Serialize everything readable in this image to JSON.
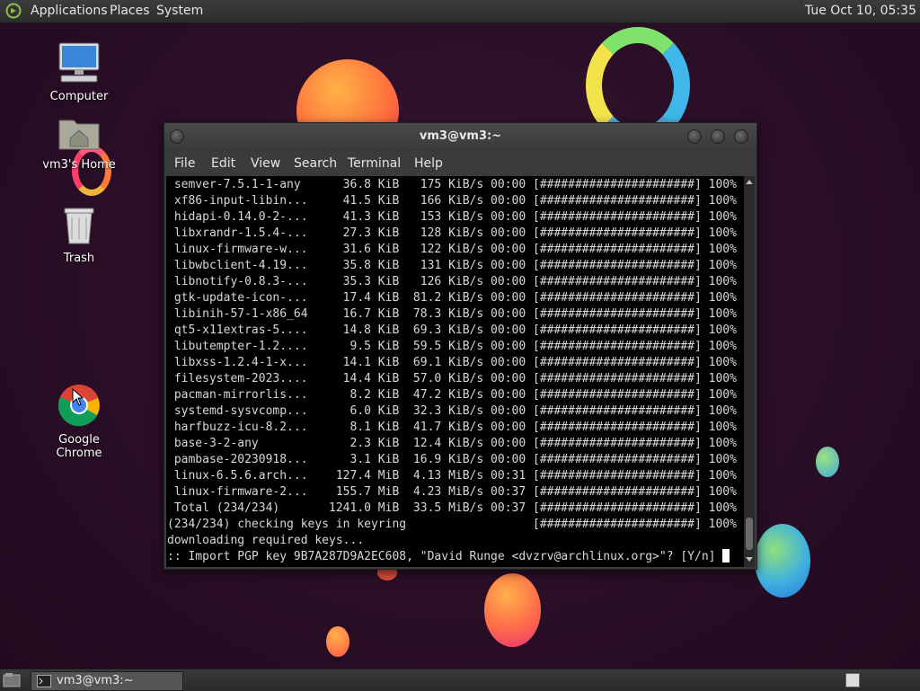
{
  "top_panel": {
    "menus": [
      "Applications",
      "Places",
      "System"
    ],
    "clock": "Tue Oct 10, 05:35"
  },
  "desktop": {
    "icons": [
      {
        "label": "Computer",
        "icon": "computer-icon"
      },
      {
        "label": "vm3's Home",
        "icon": "home-folder-icon"
      },
      {
        "label": "Trash",
        "icon": "trash-icon"
      },
      {
        "label": "Google Chrome",
        "icon": "chrome-icon"
      }
    ]
  },
  "window": {
    "title": "vm3@vm3:~",
    "menu": [
      "File",
      "Edit",
      "View",
      "Search",
      "Terminal",
      "Help"
    ],
    "terminal_lines": [
      " semver-7.5.1-1-any      36.8 KiB   175 KiB/s 00:00 [######################] 100%",
      " xf86-input-libin...     41.5 KiB   166 KiB/s 00:00 [######################] 100%",
      " hidapi-0.14.0-2-...     41.3 KiB   153 KiB/s 00:00 [######################] 100%",
      " libxrandr-1.5.4-...     27.3 KiB   128 KiB/s 00:00 [######################] 100%",
      " linux-firmware-w...     31.6 KiB   122 KiB/s 00:00 [######################] 100%",
      " libwbclient-4.19...     35.8 KiB   131 KiB/s 00:00 [######################] 100%",
      " libnotify-0.8.3-...     35.3 KiB   126 KiB/s 00:00 [######################] 100%",
      " gtk-update-icon-...     17.4 KiB  81.2 KiB/s 00:00 [######################] 100%",
      " libinih-57-1-x86_64     16.7 KiB  78.3 KiB/s 00:00 [######################] 100%",
      " qt5-x11extras-5....     14.8 KiB  69.3 KiB/s 00:00 [######################] 100%",
      " libutempter-1.2....      9.5 KiB  59.5 KiB/s 00:00 [######################] 100%",
      " libxss-1.2.4-1-x...     14.1 KiB  69.1 KiB/s 00:00 [######################] 100%",
      " filesystem-2023....     14.4 KiB  57.0 KiB/s 00:00 [######################] 100%",
      " pacman-mirrorlis...      8.2 KiB  47.2 KiB/s 00:00 [######################] 100%",
      " systemd-sysvcomp...      6.0 KiB  32.3 KiB/s 00:00 [######################] 100%",
      " harfbuzz-icu-8.2...      8.1 KiB  41.7 KiB/s 00:00 [######################] 100%",
      " base-3-2-any             2.3 KiB  12.4 KiB/s 00:00 [######################] 100%",
      " pambase-20230918...      3.1 KiB  16.9 KiB/s 00:00 [######################] 100%",
      " linux-6.5.6.arch...    127.4 MiB  4.13 MiB/s 00:31 [######################] 100%",
      " linux-firmware-2...    155.7 MiB  4.23 MiB/s 00:37 [######################] 100%",
      " Total (234/234)       1241.0 MiB  33.5 MiB/s 00:37 [######################] 100%",
      "(234/234) checking keys in keyring                  [######################] 100%",
      "downloading required keys...",
      ":: Import PGP key 9B7A287D9A2EC608, \"David Runge <dvzrv@archlinux.org>\"? [Y/n] "
    ]
  },
  "taskbar": {
    "tasks": [
      {
        "label": "vm3@vm3:~",
        "icon": "terminal-icon"
      }
    ]
  }
}
